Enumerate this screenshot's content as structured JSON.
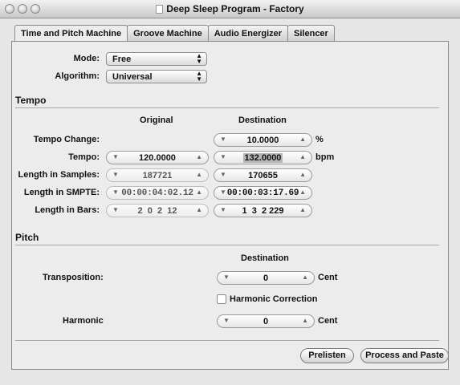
{
  "window": {
    "title": "Deep Sleep Program - Factory"
  },
  "tabs": [
    {
      "label": "Time and Pitch Machine"
    },
    {
      "label": "Groove Machine"
    },
    {
      "label": "Audio Energizer"
    },
    {
      "label": "Silencer"
    }
  ],
  "settings": {
    "mode_label": "Mode:",
    "mode_value": "Free",
    "algorithm_label": "Algorithm:",
    "algorithm_value": "Universal"
  },
  "tempo": {
    "section_title": "Tempo",
    "col_original": "Original",
    "col_destination": "Destination",
    "rows": [
      {
        "label": "Tempo Change:",
        "original": "",
        "destination": "10.0000",
        "unit": "%"
      },
      {
        "label": "Tempo:",
        "original": "120.0000",
        "destination": "132.0000",
        "unit": "bpm"
      },
      {
        "label": "Length in Samples:",
        "original": "187721",
        "destination": "170655",
        "unit": ""
      },
      {
        "label": "Length in SMPTE:",
        "original": "00:00:04:02.12",
        "destination": "00:00:03:17.69",
        "unit": ""
      },
      {
        "label": "Length in Bars:",
        "original": "2  0  2  12",
        "destination": "1  3  2 229",
        "unit": ""
      }
    ]
  },
  "pitch": {
    "section_title": "Pitch",
    "col_destination": "Destination",
    "transposition_label": "Transposition:",
    "transposition_value": "0",
    "transposition_unit": "Cent",
    "harmonic_correction_label": "Harmonic Correction",
    "harmonic_correction_checked": false,
    "harmonic_label": "Harmonic",
    "harmonic_value": "0",
    "harmonic_unit": "Cent"
  },
  "actions": {
    "prelisten": "Prelisten",
    "process": "Process and Paste"
  },
  "icons": {
    "stepper_down": "▼",
    "stepper_up": "▲",
    "popup_arrows": "▲▼"
  }
}
